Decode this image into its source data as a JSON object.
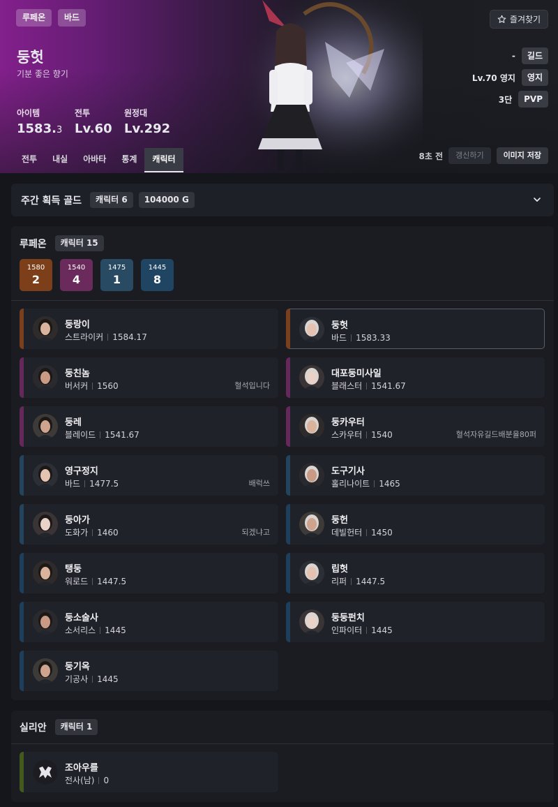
{
  "header": {
    "server_chip": "루페온",
    "class_chip": "바드",
    "name": "둥헛",
    "title": "기분 좋은 향기",
    "stats": [
      {
        "label": "아이템",
        "value": "1583.",
        "value_small": "3"
      },
      {
        "label": "전투",
        "value": "Lv.60",
        "value_small": ""
      },
      {
        "label": "원정대",
        "value": "Lv.292",
        "value_small": ""
      }
    ],
    "favorite_label": "즐겨찾기",
    "guild_value": "-",
    "guild_label": "길드",
    "estate_value": "Lv.70 영지",
    "estate_label": "영지",
    "pvp_value": "3단",
    "pvp_label": "PVP",
    "tabs": [
      "전투",
      "내실",
      "아바타",
      "통계",
      "캐릭터"
    ],
    "active_tab": "캐릭터",
    "updated_ago": "8초 전",
    "refresh_label": "갱신하기",
    "save_image_label": "이미지 저장"
  },
  "weekly_gold": {
    "title": "주간 획득 골드",
    "character_tag": "캐릭터 6",
    "gold_tag": "104000 G"
  },
  "servers": [
    {
      "name": "루페온",
      "count_tag": "캐릭터 15",
      "level_badges": [
        {
          "tier": "1580",
          "count": "2",
          "color": "#7c3f1a"
        },
        {
          "tier": "1540",
          "count": "4",
          "color": "#6b2a5c"
        },
        {
          "tier": "1475",
          "count": "1",
          "color": "#284a63"
        },
        {
          "tier": "1445",
          "count": "8",
          "color": "#1f4563"
        }
      ],
      "characters": [
        {
          "name": "둥랑이",
          "class": "스트라이커",
          "level": "1584.17",
          "memo": "",
          "color": "#7a3f1c"
        },
        {
          "name": "둥헛",
          "class": "바드",
          "level": "1583.33",
          "memo": "",
          "color": "#7a3f1c"
        },
        {
          "name": "둥친놈",
          "class": "버서커",
          "level": "1560",
          "memo": "혈석입니다",
          "color": "#64285a"
        },
        {
          "name": "대포둥미사일",
          "class": "블래스터",
          "level": "1541.67",
          "memo": "",
          "color": "#64285a"
        },
        {
          "name": "둥레",
          "class": "블레이드",
          "level": "1541.67",
          "memo": "",
          "color": "#64285a"
        },
        {
          "name": "둥카우터",
          "class": "스카우터",
          "level": "1540",
          "memo": "혈석자유길드배분율80퍼",
          "color": "#64285a"
        },
        {
          "name": "영구정지",
          "class": "바드",
          "level": "1477.5",
          "memo": "배럭쓰",
          "color": "#23445c"
        },
        {
          "name": "도구기사",
          "class": "홀리나이트",
          "level": "1465",
          "memo": "",
          "color": "#23445c"
        },
        {
          "name": "둥아가",
          "class": "도화가",
          "level": "1460",
          "memo": "되겠냐고",
          "color": "#23445c"
        },
        {
          "name": "둥헌",
          "class": "데빌헌터",
          "level": "1450",
          "memo": "",
          "color": "#1d3f5c"
        },
        {
          "name": "탱둥",
          "class": "워로드",
          "level": "1447.5",
          "memo": "",
          "color": "#1d3f5c"
        },
        {
          "name": "립헛",
          "class": "리퍼",
          "level": "1447.5",
          "memo": "",
          "color": "#1d3f5c"
        },
        {
          "name": "둥소술사",
          "class": "소서리스",
          "level": "1445",
          "memo": "",
          "color": "#1d3f5c"
        },
        {
          "name": "둥둥펀치",
          "class": "인파이터",
          "level": "1445",
          "memo": "",
          "color": "#1d3f5c"
        },
        {
          "name": "둥기옥",
          "class": "기공사",
          "level": "1445",
          "memo": "",
          "color": "#1d3f5c"
        }
      ]
    },
    {
      "name": "실리안",
      "count_tag": "캐릭터 1",
      "characters": [
        {
          "name": "조아우를",
          "class": "전사(남)",
          "level": "0",
          "memo": "",
          "color": "#445a1c"
        }
      ]
    }
  ]
}
